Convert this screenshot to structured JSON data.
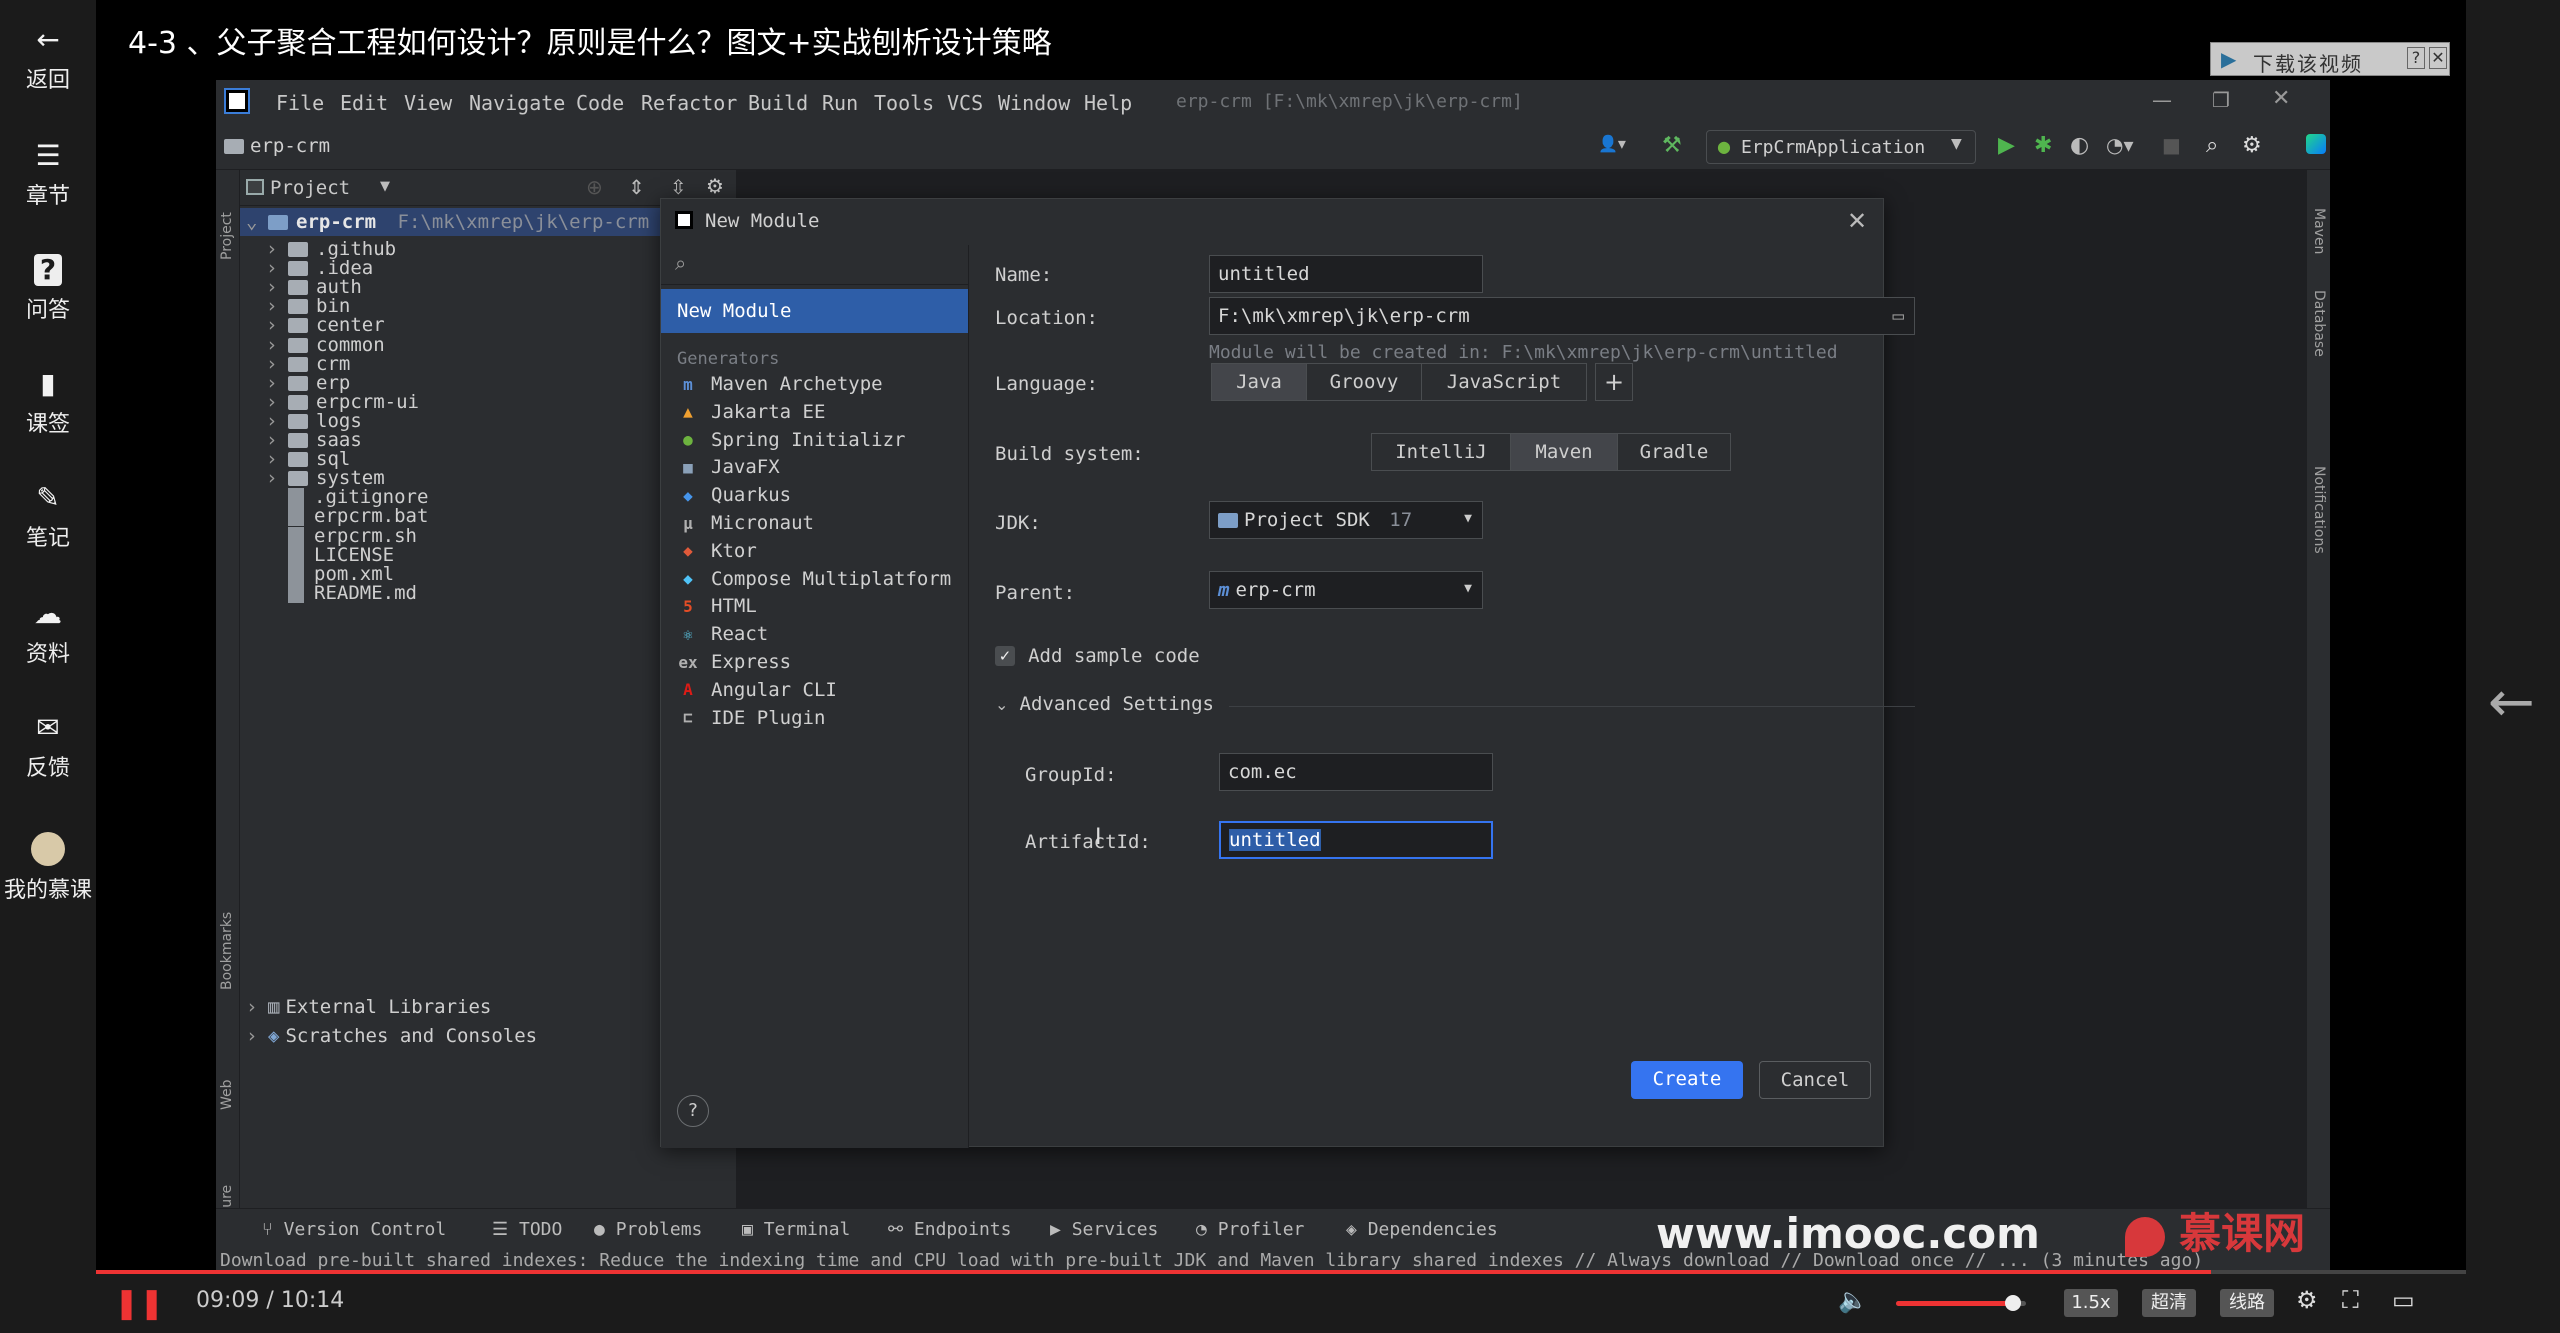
{
  "player": {
    "title": "4-3 、父子聚合工程如何设计？原则是什么？图文+实战刨析设计策略",
    "download_label": "下载该视频",
    "left_items": [
      {
        "label": "返回",
        "icon": "arrow-left-icon"
      },
      {
        "label": "章节",
        "icon": "menu-icon"
      },
      {
        "label": "问答",
        "icon": "question-icon"
      },
      {
        "label": "课签",
        "icon": "bookmark-icon"
      },
      {
        "label": "笔记",
        "icon": "pencil-icon"
      },
      {
        "label": "资料",
        "icon": "cloud-download-icon"
      },
      {
        "label": "反馈",
        "icon": "mail-icon"
      },
      {
        "label": "我的慕课",
        "icon": "avatar-icon"
      }
    ],
    "time_current": "09:09",
    "time_total": "10:14",
    "time_sep": "/",
    "progress_fraction": 0.8925,
    "volume_fraction": 0.9,
    "speed_label": "1.5x",
    "quality_label": "超清",
    "line_label": "线路",
    "watermark_site": "www.imooc.com",
    "watermark_brand": "慕课网"
  },
  "ide": {
    "menu": [
      "File",
      "Edit",
      "View",
      "Navigate",
      "Code",
      "Refactor",
      "Build",
      "Run",
      "Tools",
      "VCS",
      "Window",
      "Help"
    ],
    "window_title": "erp-crm [F:\\mk\\xmrep\\jk\\erp-crm]",
    "breadcrumb": "erp-crm",
    "run_config": "ErpCrmApplication",
    "project_label": "Project",
    "project_root": "erp-crm",
    "project_root_path": "F:\\mk\\xmrep\\jk\\erp-crm",
    "tree": [
      {
        "name": ".github",
        "type": "folder"
      },
      {
        "name": ".idea",
        "type": "folder"
      },
      {
        "name": "auth",
        "type": "folder"
      },
      {
        "name": "bin",
        "type": "folder"
      },
      {
        "name": "center",
        "type": "folder"
      },
      {
        "name": "common",
        "type": "folder"
      },
      {
        "name": "crm",
        "type": "folder"
      },
      {
        "name": "erp",
        "type": "folder"
      },
      {
        "name": "erpcrm-ui",
        "type": "folder"
      },
      {
        "name": "logs",
        "type": "folder"
      },
      {
        "name": "saas",
        "type": "folder"
      },
      {
        "name": "sql",
        "type": "folder"
      },
      {
        "name": "system",
        "type": "folder"
      },
      {
        "name": ".gitignore",
        "type": "file"
      },
      {
        "name": "erpcrm.bat",
        "type": "file"
      },
      {
        "name": "erpcrm.sh",
        "type": "file"
      },
      {
        "name": "LICENSE",
        "type": "file"
      },
      {
        "name": "pom.xml",
        "type": "file"
      },
      {
        "name": "README.md",
        "type": "file"
      }
    ],
    "external_libraries": "External Libraries",
    "scratches": "Scratches and Consoles",
    "left_strip": [
      "Project",
      "Bookmarks",
      "Web",
      "Structure"
    ],
    "right_strip": [
      "Maven",
      "Database",
      "Notifications"
    ],
    "tool_windows": [
      "Version Control",
      "TODO",
      "Problems",
      "Terminal",
      "Endpoints",
      "Services",
      "Profiler",
      "Dependencies"
    ],
    "status": "Download pre-built shared indexes: Reduce the indexing time and CPU load with pre-built JDK and Maven library shared indexes // Always download // Download once // ... (3 minutes ago)"
  },
  "dialog": {
    "title": "New Module",
    "selected_item": "New Module",
    "generators_header": "Generators",
    "generators": [
      {
        "label": "Maven Archetype",
        "icon": "maven-icon",
        "color": "#5c8fd6",
        "glyph": "m"
      },
      {
        "label": "Jakarta EE",
        "icon": "jakarta-icon",
        "color": "#f0a030",
        "glyph": "▲"
      },
      {
        "label": "Spring Initializr",
        "icon": "spring-icon",
        "color": "#6db33f",
        "glyph": "●"
      },
      {
        "label": "JavaFX",
        "icon": "javafx-icon",
        "color": "#8aa0b8",
        "glyph": "■"
      },
      {
        "label": "Quarkus",
        "icon": "quarkus-icon",
        "color": "#4695eb",
        "glyph": "◆"
      },
      {
        "label": "Micronaut",
        "icon": "micronaut-icon",
        "color": "#b0b0b0",
        "glyph": "μ"
      },
      {
        "label": "Ktor",
        "icon": "ktor-icon",
        "color": "#e05a3a",
        "glyph": "◆"
      },
      {
        "label": "Compose Multiplatform",
        "icon": "compose-icon",
        "color": "#4fc3f7",
        "glyph": "◆"
      },
      {
        "label": "HTML",
        "icon": "html-icon",
        "color": "#e44d26",
        "glyph": "5"
      },
      {
        "label": "React",
        "icon": "react-icon",
        "color": "#61dafb",
        "glyph": "⚛"
      },
      {
        "label": "Express",
        "icon": "express-icon",
        "color": "#b0b0b0",
        "glyph": "ex"
      },
      {
        "label": "Angular CLI",
        "icon": "angular-icon",
        "color": "#dd1b16",
        "glyph": "A"
      },
      {
        "label": "IDE Plugin",
        "icon": "plugin-icon",
        "color": "#b0b0b0",
        "glyph": "⊏"
      }
    ],
    "name_label": "Name:",
    "name_value": "untitled",
    "location_label": "Location:",
    "location_value": "F:\\mk\\xmrep\\jk\\erp-crm",
    "location_hint": "Module will be created in: F:\\mk\\xmrep\\jk\\erp-crm\\untitled",
    "language_label": "Language:",
    "languages": [
      "Java",
      "Groovy",
      "JavaScript"
    ],
    "language_selected": "Java",
    "build_label": "Build system:",
    "build_systems": [
      "IntelliJ",
      "Maven",
      "Gradle"
    ],
    "build_selected": "Maven",
    "jdk_label": "JDK:",
    "jdk_value": "Project SDK",
    "jdk_version": "17",
    "parent_label": "Parent:",
    "parent_value": "erp-crm",
    "sample_code_label": "Add sample code",
    "sample_code_checked": true,
    "advanced_label": "Advanced Settings",
    "groupid_label": "GroupId:",
    "groupid_value": "com.ec",
    "artifactid_label": "ArtifactId:",
    "artifactid_value": "untitled",
    "create_label": "Create",
    "cancel_label": "Cancel",
    "help_label": "?"
  },
  "colors": {
    "accent": "#3574f0",
    "selection": "#2e5ea8",
    "bg": "#2b2d30",
    "editor": "#1e1f22",
    "progress": "#e33333"
  }
}
